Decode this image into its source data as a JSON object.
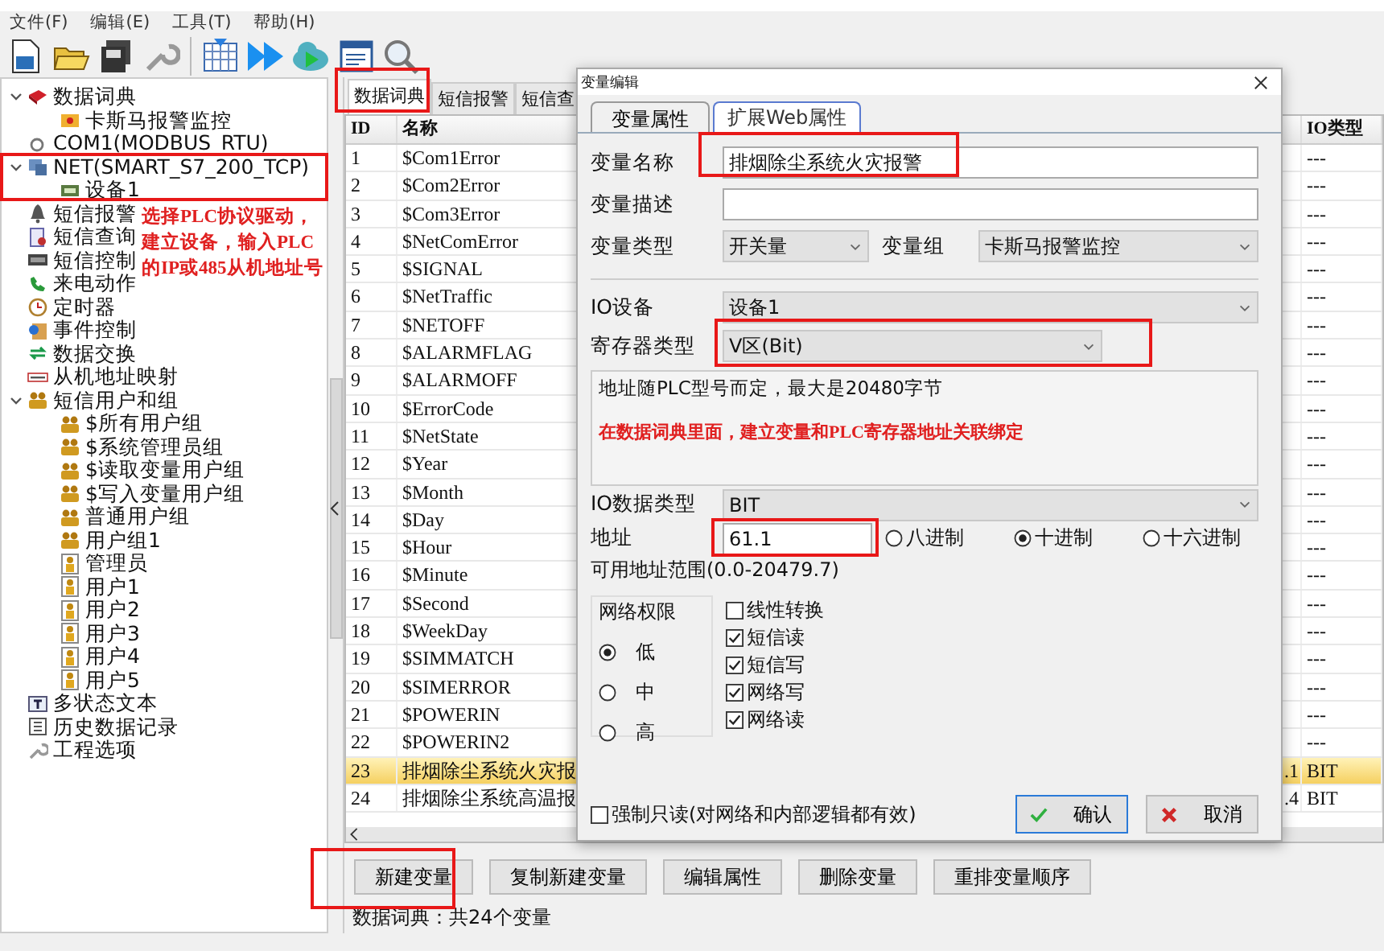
{
  "menu": [
    "文件(F)",
    "编辑(E)",
    "工具(T)",
    "帮助(H)"
  ],
  "tree": [
    {
      "label": "数据词典",
      "kind": "dictionary",
      "expanded": true,
      "children": [
        {
          "label": "卡斯马报警监控",
          "kind": "group"
        }
      ]
    },
    {
      "label": "COM1(MODBUS_RTU)",
      "kind": "com"
    },
    {
      "label": "NET(SMART_S7_200_TCP)",
      "kind": "net",
      "expanded": true,
      "children": [
        {
          "label": "设备1",
          "kind": "device"
        }
      ]
    },
    {
      "label": "短信报警",
      "kind": "bell"
    },
    {
      "label": "短信查询",
      "kind": "query"
    },
    {
      "label": "短信控制",
      "kind": "control"
    },
    {
      "label": "来电动作",
      "kind": "phone"
    },
    {
      "label": "定时器",
      "kind": "timer"
    },
    {
      "label": "事件控制",
      "kind": "event"
    },
    {
      "label": "数据交换",
      "kind": "exchange"
    },
    {
      "label": "从机地址映射",
      "kind": "mapping"
    },
    {
      "label": "短信用户和组",
      "kind": "users",
      "expanded": true,
      "children": [
        {
          "label": "$所有用户组",
          "kind": "usergroup"
        },
        {
          "label": "$系统管理员组",
          "kind": "usergroup"
        },
        {
          "label": "$读取变量用户组",
          "kind": "usergroup"
        },
        {
          "label": "$写入变量用户组",
          "kind": "usergroup"
        },
        {
          "label": "普通用户组",
          "kind": "usergroup"
        },
        {
          "label": "用户组1",
          "kind": "usergroup"
        },
        {
          "label": "管理员",
          "kind": "user"
        },
        {
          "label": "用户1",
          "kind": "user"
        },
        {
          "label": "用户2",
          "kind": "user"
        },
        {
          "label": "用户3",
          "kind": "user"
        },
        {
          "label": "用户4",
          "kind": "user"
        },
        {
          "label": "用户5",
          "kind": "user"
        }
      ]
    },
    {
      "label": "多状态文本",
      "kind": "text"
    },
    {
      "label": "历史数据记录",
      "kind": "history"
    },
    {
      "label": "工程选项",
      "kind": "options"
    }
  ],
  "tree_note": "选择PLC协议驱动，建立设备，输入PLC的IP或485从机地址号",
  "tabs": [
    {
      "label": "数据词典",
      "selected": true
    },
    {
      "label": "短信报警",
      "selected": false
    },
    {
      "label": "短信查",
      "selected": false
    }
  ],
  "table": {
    "columns": [
      "ID",
      "名称",
      "IO类型"
    ],
    "rows": [
      {
        "id": "1",
        "name": "$Com1Error",
        "io_type": "---",
        "selected": false
      },
      {
        "id": "2",
        "name": "$Com2Error",
        "io_type": "---",
        "selected": false
      },
      {
        "id": "3",
        "name": "$Com3Error",
        "io_type": "---",
        "selected": false
      },
      {
        "id": "4",
        "name": "$NetComError",
        "io_type": "---",
        "selected": false
      },
      {
        "id": "5",
        "name": "$SIGNAL",
        "io_type": "---",
        "selected": false
      },
      {
        "id": "6",
        "name": "$NetTraffic",
        "io_type": "---",
        "selected": false
      },
      {
        "id": "7",
        "name": "$NETOFF",
        "io_type": "---",
        "selected": false
      },
      {
        "id": "8",
        "name": "$ALARMFLAG",
        "io_type": "---",
        "selected": false
      },
      {
        "id": "9",
        "name": "$ALARMOFF",
        "io_type": "---",
        "selected": false
      },
      {
        "id": "10",
        "name": "$ErrorCode",
        "io_type": "---",
        "selected": false
      },
      {
        "id": "11",
        "name": "$NetState",
        "io_type": "---",
        "selected": false
      },
      {
        "id": "12",
        "name": "$Year",
        "io_type": "---",
        "selected": false
      },
      {
        "id": "13",
        "name": "$Month",
        "io_type": "---",
        "selected": false
      },
      {
        "id": "14",
        "name": "$Day",
        "io_type": "---",
        "selected": false
      },
      {
        "id": "15",
        "name": "$Hour",
        "io_type": "---",
        "selected": false
      },
      {
        "id": "16",
        "name": "$Minute",
        "io_type": "---",
        "selected": false
      },
      {
        "id": "17",
        "name": "$Second",
        "io_type": "---",
        "selected": false
      },
      {
        "id": "18",
        "name": "$WeekDay",
        "io_type": "---",
        "selected": false
      },
      {
        "id": "19",
        "name": "$SIMMATCH",
        "io_type": "---",
        "selected": false
      },
      {
        "id": "20",
        "name": "$SIMERROR",
        "io_type": "---",
        "selected": false
      },
      {
        "id": "21",
        "name": "$POWERIN",
        "io_type": "---",
        "selected": false
      },
      {
        "id": "22",
        "name": "$POWERIN2",
        "io_type": "---",
        "selected": false
      },
      {
        "id": "23",
        "name": "排烟除尘系统火灾报",
        "column_3": ".1",
        "io_type": "BIT",
        "selected": true
      },
      {
        "id": "24",
        "name": "排烟除尘系统高温报",
        "column_3": ".4",
        "io_type": "BIT",
        "selected": false
      }
    ]
  },
  "buttons": [
    "新建变量",
    "复制新建变量",
    "编辑属性",
    "删除变量",
    "重排变量顺序"
  ],
  "status_bar": "数据词典：共24个变量",
  "dialog": {
    "title": "变量编辑",
    "tabs": [
      {
        "label": "变量属性",
        "selected": true
      },
      {
        "label": "扩展Web属性",
        "selected": false
      }
    ],
    "name_label": "变量名称",
    "name_value": "排烟除尘系统火灾报警",
    "desc_label": "变量描述",
    "type_label": "变量类型",
    "type_value": "开关量",
    "group_label": "变量组",
    "group_value": "卡斯马报警监控",
    "io_device_label": "IO设备",
    "io_device_value": "设备1",
    "register_label": "寄存器类型",
    "register_value": "V区(Bit)",
    "info_text": "地址随PLC型号而定，最大是20480字节",
    "info_note": "在数据词典里面，建立变量和PLC寄存器地址关联绑定",
    "data_type_label": "IO数据类型",
    "data_type_value": "BIT",
    "address_label": "地址",
    "address_value": "61.1",
    "radix": [
      {
        "label": "八进制",
        "selected": false
      },
      {
        "label": "十进制",
        "selected": true
      },
      {
        "label": "十六进制",
        "selected": false
      }
    ],
    "range_text": "可用地址范围(0.0-20479.7)",
    "permission": {
      "title": "网络权限",
      "options": [
        {
          "label": "低",
          "selected": true
        },
        {
          "label": "中",
          "selected": false
        },
        {
          "label": "高",
          "selected": false
        }
      ]
    },
    "options": [
      {
        "label": "线性转换",
        "checked": false
      },
      {
        "label": "短信读",
        "checked": true
      },
      {
        "label": "短信写",
        "checked": true
      },
      {
        "label": "网络写",
        "checked": true
      },
      {
        "label": "网络读",
        "checked": true
      }
    ],
    "readonly": {
      "label": "强制只读(对网络和内部逻辑都有效)",
      "checked": false
    },
    "buttons": [
      {
        "label": "确认",
        "kind": "ok"
      },
      {
        "label": "取消",
        "kind": "cancel"
      }
    ]
  }
}
